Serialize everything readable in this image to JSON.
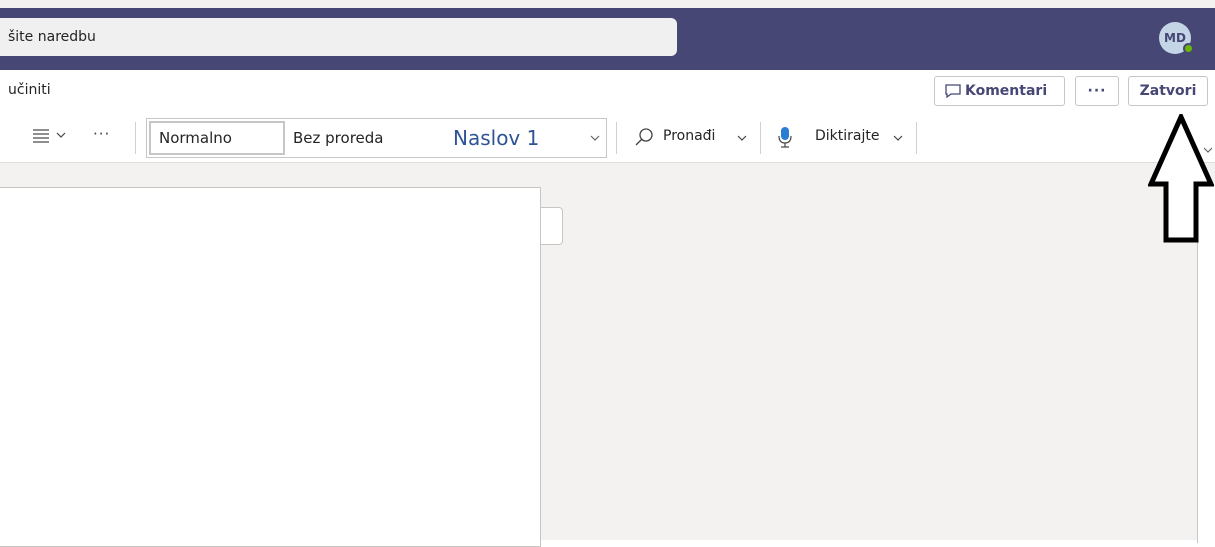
{
  "titlebar": {
    "command_placeholder": "šite naredbu",
    "avatar_initials": "MD"
  },
  "header": {
    "doc_title": "učiniti",
    "comments_label": "Komentari",
    "more_label": "···",
    "close_label": "Zatvori"
  },
  "ribbon": {
    "more_label": "···",
    "styles": [
      "Normalno",
      "Bez proreda",
      "Naslov 1"
    ],
    "find_label": "Pronađi",
    "dictate_label": "Diktirajte"
  },
  "icons": [
    "align-icon",
    "chevron-down-icon",
    "comment-icon",
    "search-icon",
    "microphone-icon",
    "arrow-up-icon"
  ],
  "colors": {
    "titlebar": "#464775",
    "heading_style": "#2f5496",
    "presence": "#6bb700"
  }
}
